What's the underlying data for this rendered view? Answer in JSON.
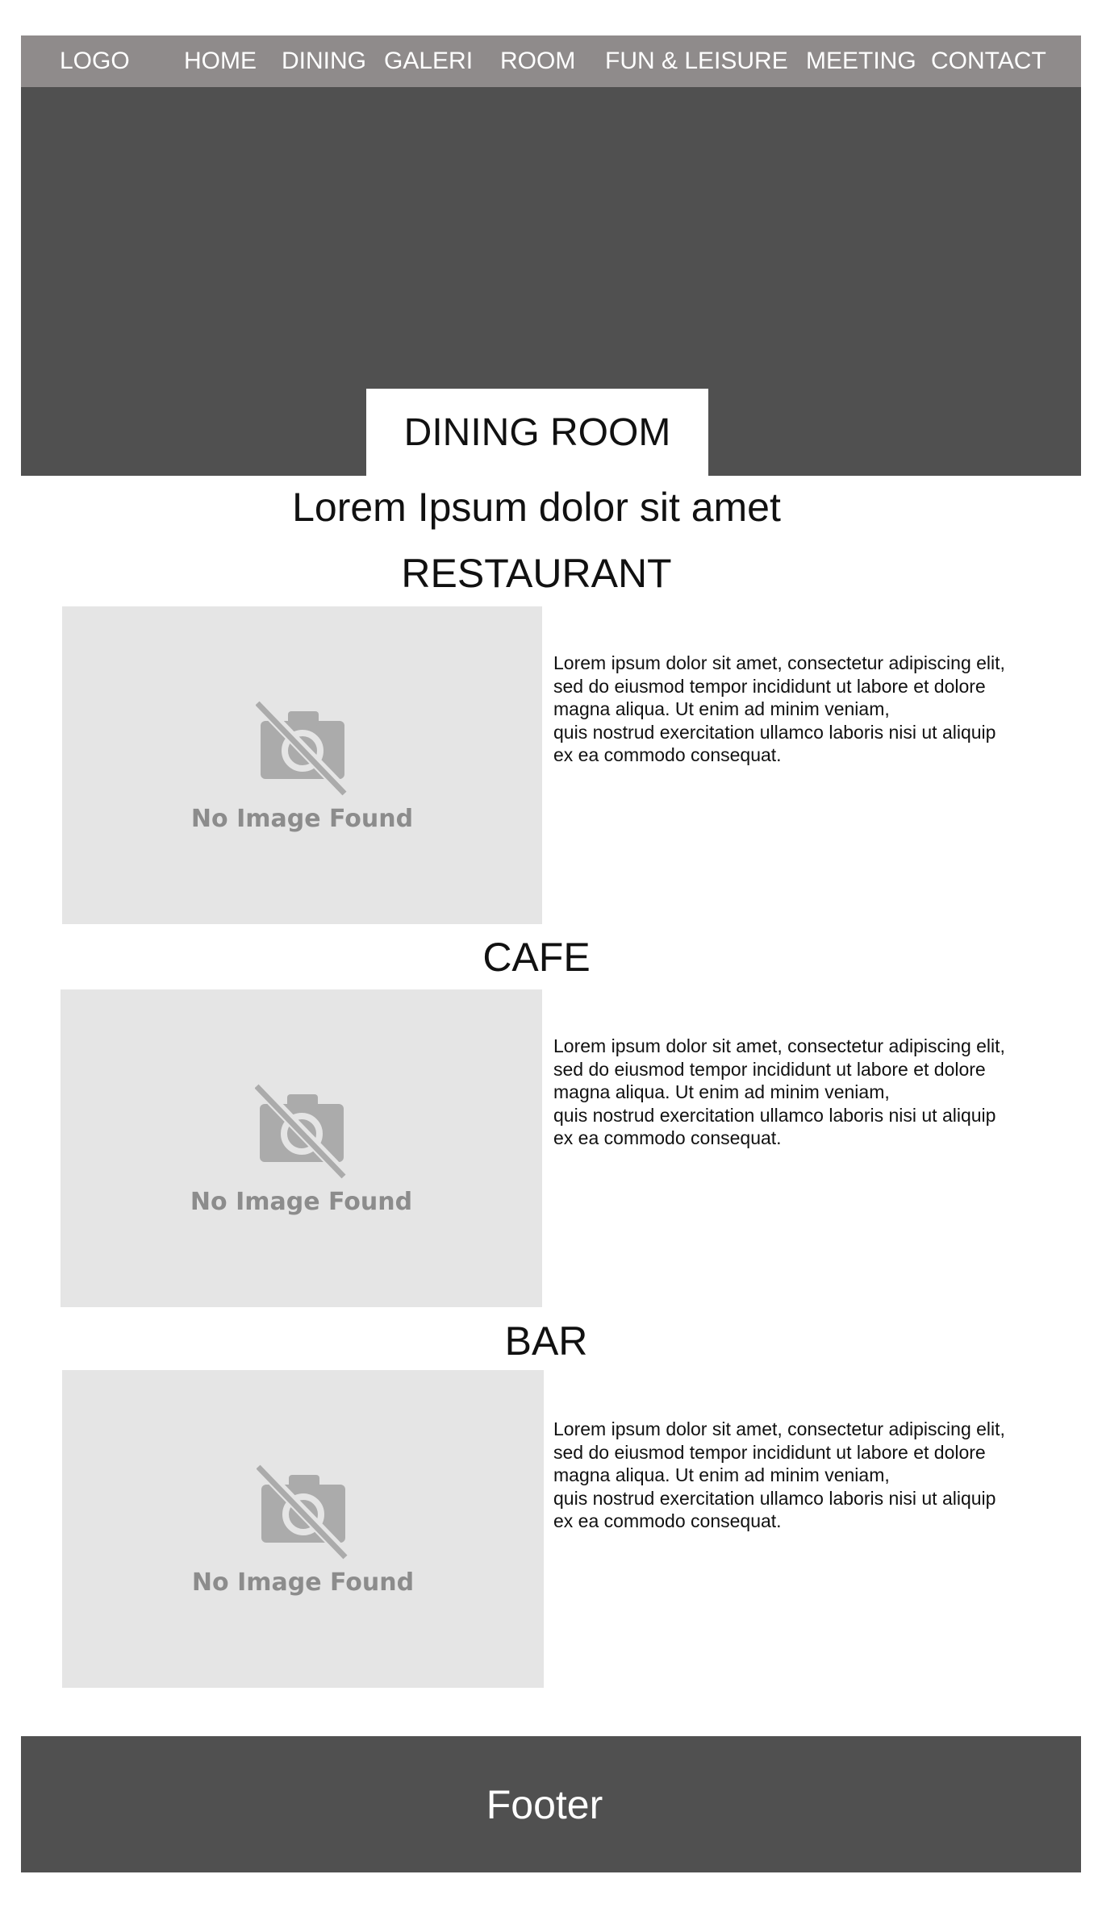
{
  "nav": {
    "logo": "LOGO",
    "items": [
      {
        "label": "HOME"
      },
      {
        "label": "DINING"
      },
      {
        "label": "GALERI"
      },
      {
        "label": "ROOM"
      },
      {
        "label": "FUN & LEISURE"
      },
      {
        "label": "MEETING"
      },
      {
        "label": "CONTACT"
      }
    ]
  },
  "hero": {
    "title": "DINING ROOM"
  },
  "subtitle": "Lorem Ipsum dolor sit amet",
  "sections": [
    {
      "heading": "RESTAURANT",
      "image_placeholder": "No Image Found",
      "image_icon": "no-image-camera-icon",
      "description_lines": [
        "Lorem ipsum dolor sit amet, consectetur adipiscing elit,",
        "sed do eiusmod tempor incididunt ut labore et dolore",
        "magna aliqua. Ut enim ad minim veniam,",
        "quis nostrud exercitation ullamco laboris nisi ut aliquip",
        "ex ea commodo consequat."
      ]
    },
    {
      "heading": "CAFE",
      "image_placeholder": "No Image Found",
      "image_icon": "no-image-camera-icon",
      "description_lines": [
        "Lorem ipsum dolor sit amet, consectetur adipiscing elit,",
        "sed do eiusmod tempor incididunt ut labore et dolore",
        "magna aliqua. Ut enim ad minim veniam,",
        "quis nostrud exercitation ullamco laboris nisi ut aliquip",
        "ex ea commodo consequat."
      ]
    },
    {
      "heading": "BAR",
      "image_placeholder": "No Image Found",
      "image_icon": "no-image-camera-icon",
      "description_lines": [
        "Lorem ipsum dolor sit amet, consectetur adipiscing elit,",
        "sed do eiusmod tempor incididunt ut labore et dolore",
        "magna aliqua. Ut enim ad minim veniam,",
        "quis nostrud exercitation ullamco laboris nisi ut aliquip",
        "ex ea commodo consequat."
      ]
    }
  ],
  "footer": {
    "text": "Footer"
  },
  "colors": {
    "nav_bg": "#8f8b8b",
    "hero_bg": "#505050",
    "footer_bg": "#505050",
    "placeholder_bg": "#e5e5e5",
    "placeholder_fg": "#8c8c8c"
  }
}
